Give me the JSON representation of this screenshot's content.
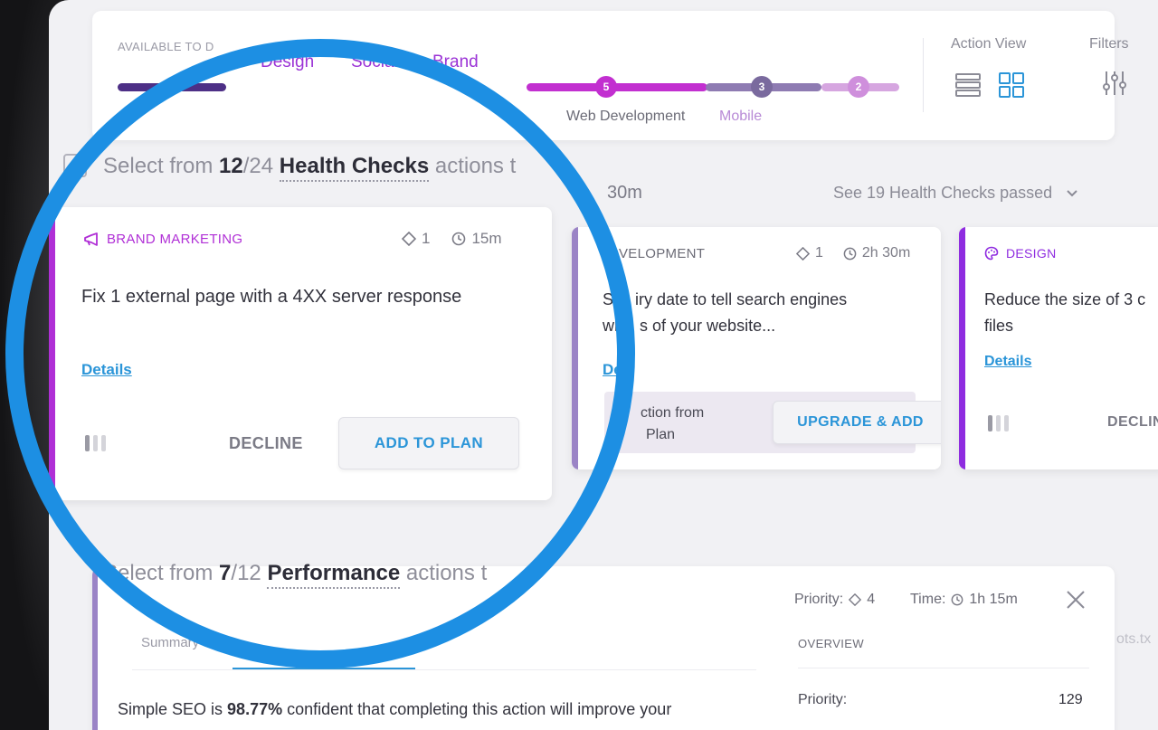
{
  "top": {
    "available_label": "AVAILABLE TO D",
    "tabs": [
      "Design",
      "Social",
      "Brand"
    ],
    "badges": [
      "5",
      "3",
      "2"
    ],
    "track_labels": [
      "Web Development",
      "Mobile"
    ],
    "action_view_label": "Action View",
    "filters_label": "Filters"
  },
  "health": {
    "prefix": "Select from ",
    "selected": "12",
    "slash": "/",
    "total": "24",
    "name": "Health Checks",
    "suffix": " actions t",
    "time_fragment": "30m",
    "passed_link": "See 19 Health Checks passed"
  },
  "cards": [
    {
      "category": "BRAND MARKETING",
      "priority": "1",
      "time": "15m",
      "text": "Fix 1 external page with a 4XX server response",
      "details": "Details",
      "decline": "DECLINE",
      "primary": "ADD TO PLAN",
      "color": "#b02fd6"
    },
    {
      "category": "VELOPMENT",
      "priority": "1",
      "time": "2h 30m",
      "text_1": "Se",
      "text_2": "iry date to tell search engines",
      "text_3": "wh",
      "text_4": "s of your website...",
      "details": "De",
      "upgrade_text_1": "ction from",
      "upgrade_text_2": "Plan",
      "primary": "UPGRADE & ADD",
      "color": "#9b84c6"
    },
    {
      "category": "DESIGN",
      "text": "Reduce the size of 3 c files",
      "details": "Details",
      "decline": "DECLIN",
      "color": "#8f2ce0"
    }
  ],
  "performance": {
    "prefix": "Select from ",
    "selected": "7",
    "slash": "/",
    "total": "12",
    "name": "Performance",
    "suffix": " actions t"
  },
  "detail": {
    "priority_label": "Priority:",
    "priority_value": "4",
    "time_label": "Time:",
    "time_value": "1h 15m",
    "summary_tab": "Summary",
    "overview_label": "OVERVIEW",
    "confidence_prefix": "Simple SEO is ",
    "confidence_value": "98.77%",
    "confidence_suffix": " confident that completing this action will improve your",
    "priority_row_label": "Priority:",
    "priority_row_value": "129",
    "side_fragment": "ots.tx"
  },
  "colors": {
    "ring": "#1d8fe3",
    "accent_purple": "#b02fd6",
    "link_blue": "#2b95d8"
  }
}
